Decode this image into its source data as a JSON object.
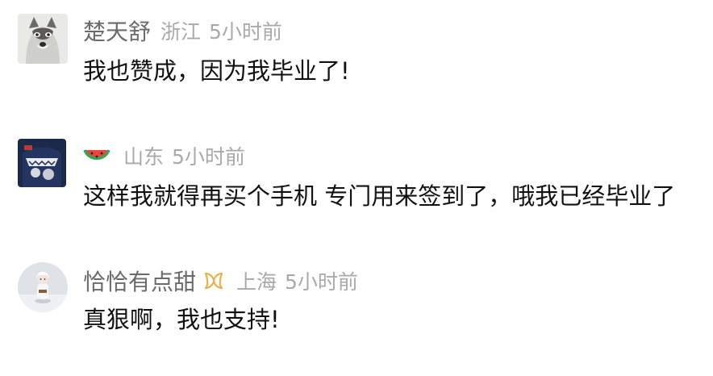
{
  "comments": [
    {
      "avatar": "husky-dog-avatar",
      "username": "楚天舒",
      "location": "浙江",
      "time": "5小时前",
      "text": "我也赞成，因为我毕业了!"
    },
    {
      "avatar": "bape-shark-avatar",
      "badge_icon": "watermelon-icon",
      "username": "",
      "location": "山东",
      "time": "5小时前",
      "text": "这样我就得再买个手机 专门用来签到了，哦我已经毕业了"
    },
    {
      "avatar": "snow-figure-avatar",
      "badge_icon": "ribbon-icon",
      "username": "恰恰有点甜",
      "location": "上海",
      "time": "5小时前",
      "text": "真狠啊，我也支持!"
    }
  ],
  "colors": {
    "username": "#6b6b6b",
    "meta": "#a9a9a9",
    "text": "#111111",
    "badge_ribbon": "#e8b24a",
    "watermelon_red": "#e8453c",
    "watermelon_green": "#3aa35a"
  }
}
